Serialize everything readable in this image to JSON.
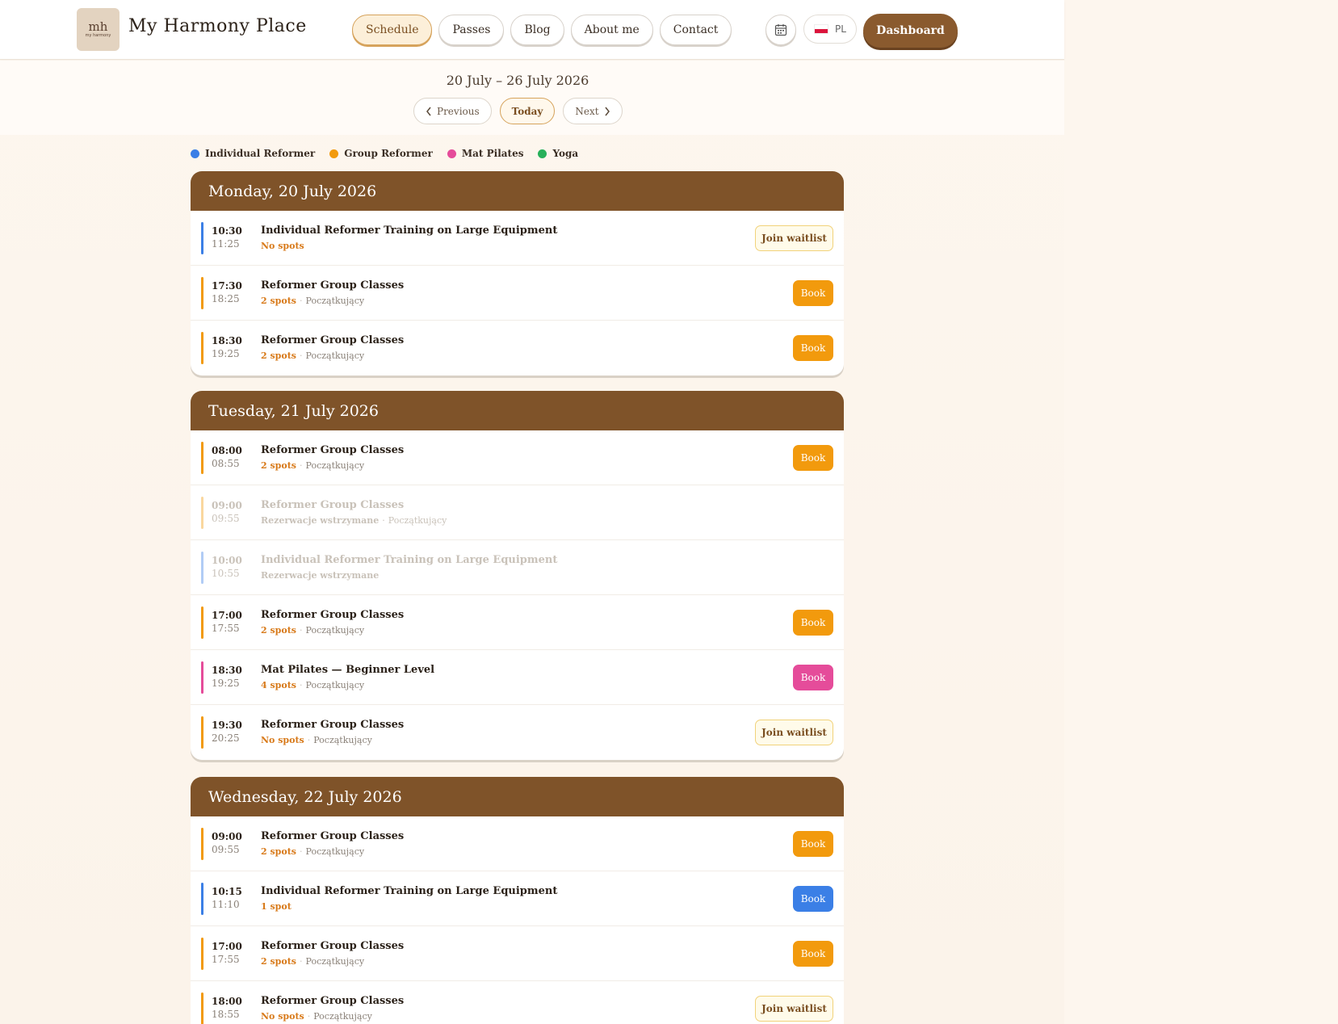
{
  "colors": {
    "individual": "#3b7fe6",
    "group": "#f29a0d",
    "mat": "#e54c9a",
    "yoga": "#27b05a",
    "brown": "#7f5329"
  },
  "header": {
    "logo_mark": "mh",
    "logo_small": "my harmony",
    "brand": "My Harmony Place",
    "nav": [
      "Schedule",
      "Passes",
      "Blog",
      "About me",
      "Contact"
    ],
    "calendar_icon": "calendar-icon",
    "lang": "PL",
    "dashboard": "Dashboard"
  },
  "week": {
    "range": "20 July – 26 July 2026",
    "prev": "Previous",
    "today": "Today",
    "next": "Next"
  },
  "legend": [
    {
      "label": "Individual Reformer",
      "color": "#3b7fe6"
    },
    {
      "label": "Group Reformer",
      "color": "#f29a0d"
    },
    {
      "label": "Mat Pilates",
      "color": "#e54c9a"
    },
    {
      "label": "Yoga",
      "color": "#27b05a"
    }
  ],
  "days": [
    {
      "title": "Monday, 20 July 2026",
      "classes": [
        {
          "start": "10:30",
          "end": "11:25",
          "title": "Individual Reformer Training on Large Equipment",
          "spots": "No spots",
          "level": "",
          "type": "individual",
          "action": "Join waitlist",
          "dim": false
        },
        {
          "start": "17:30",
          "end": "18:25",
          "title": "Reformer Group Classes",
          "spots": "2 spots",
          "level": "Początkujący",
          "type": "group",
          "action": "Book",
          "dim": false
        },
        {
          "start": "18:30",
          "end": "19:25",
          "title": "Reformer Group Classes",
          "spots": "2 spots",
          "level": "Początkujący",
          "type": "group",
          "action": "Book",
          "dim": false
        }
      ]
    },
    {
      "title": "Tuesday, 21 July 2026",
      "classes": [
        {
          "start": "08:00",
          "end": "08:55",
          "title": "Reformer Group Classes",
          "spots": "2 spots",
          "level": "Początkujący",
          "type": "group",
          "action": "Book",
          "dim": false
        },
        {
          "start": "09:00",
          "end": "09:55",
          "title": "Reformer Group Classes",
          "spots": "Rezerwacje wstrzymane",
          "level": "Początkujący",
          "type": "group",
          "action": "",
          "dim": true
        },
        {
          "start": "10:00",
          "end": "10:55",
          "title": "Individual Reformer Training on Large Equipment",
          "spots": "Rezerwacje wstrzymane",
          "level": "",
          "type": "individual",
          "action": "",
          "dim": true
        },
        {
          "start": "17:00",
          "end": "17:55",
          "title": "Reformer Group Classes",
          "spots": "2 spots",
          "level": "Początkujący",
          "type": "group",
          "action": "Book",
          "dim": false
        },
        {
          "start": "18:30",
          "end": "19:25",
          "title": "Mat Pilates — Beginner Level",
          "spots": "4 spots",
          "level": "Początkujący",
          "type": "mat",
          "action": "Book",
          "dim": false
        },
        {
          "start": "19:30",
          "end": "20:25",
          "title": "Reformer Group Classes",
          "spots": "No spots",
          "level": "Początkujący",
          "type": "group",
          "action": "Join waitlist",
          "dim": false
        }
      ]
    },
    {
      "title": "Wednesday, 22 July 2026",
      "classes": [
        {
          "start": "09:00",
          "end": "09:55",
          "title": "Reformer Group Classes",
          "spots": "2 spots",
          "level": "Początkujący",
          "type": "group",
          "action": "Book",
          "dim": false
        },
        {
          "start": "10:15",
          "end": "11:10",
          "title": "Individual Reformer Training on Large Equipment",
          "spots": "1 spot",
          "level": "",
          "type": "individual",
          "action": "Book",
          "dim": false
        },
        {
          "start": "17:00",
          "end": "17:55",
          "title": "Reformer Group Classes",
          "spots": "2 spots",
          "level": "Początkujący",
          "type": "group",
          "action": "Book",
          "dim": false
        },
        {
          "start": "18:00",
          "end": "18:55",
          "title": "Reformer Group Classes",
          "spots": "No spots",
          "level": "Początkujący",
          "type": "group",
          "action": "Join waitlist",
          "dim": false
        }
      ]
    }
  ]
}
